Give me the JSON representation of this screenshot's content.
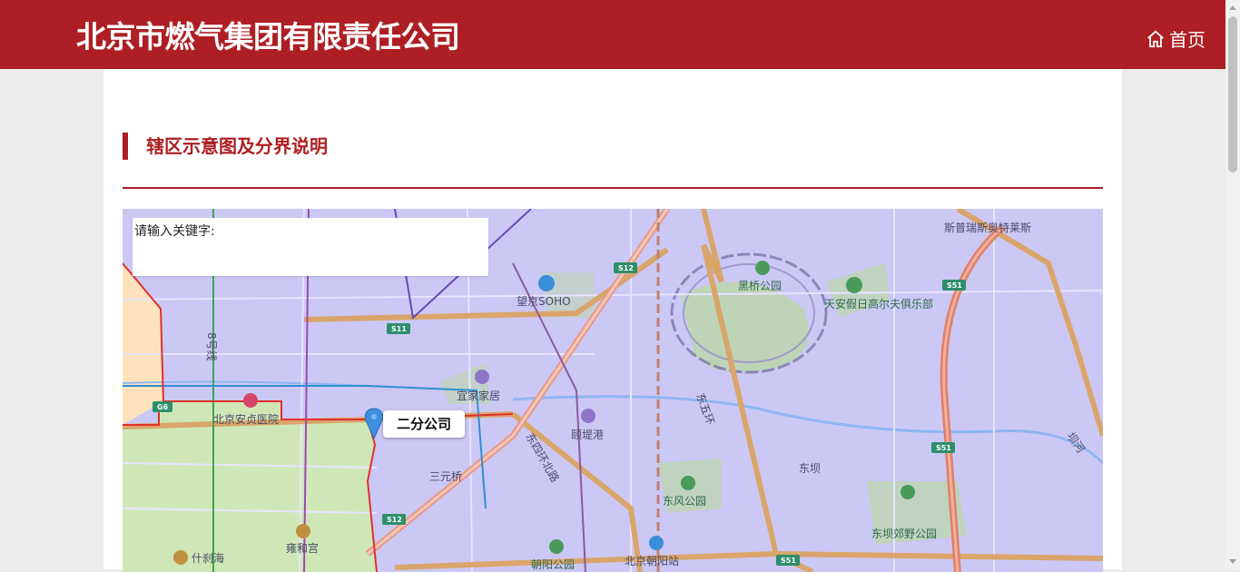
{
  "header": {
    "title": "北京市燃气集团有限责任公司",
    "home_label": "首页",
    "home_icon": "home-icon"
  },
  "section": {
    "title": "辖区示意图及分界说明"
  },
  "map": {
    "search": {
      "label": "请输入关键字:"
    },
    "marker": {
      "label": "二分公司",
      "icon": "map-pin-icon"
    },
    "places": {
      "wangjing_soho": "望京SOHO",
      "heiqiao_park": "黑桥公园",
      "tianan_golf": "天安假日高尔夫俱乐部",
      "swede_outlet": "斯普瑞斯奥特莱斯",
      "ikea": "宜家家居",
      "anzhen_hospital": "北京安贞医院",
      "yidi_port": "颐堤港",
      "dongsi_ring": "东四环北路",
      "dongwu_ring": "东五环",
      "sanyuan_bridge": "三元桥",
      "dongfeng_park": "东风公园",
      "dongba": "东坝",
      "dongba_park": "东坝郊野公园",
      "yonghe_temple": "雍和宫",
      "shichahai": "什刹海",
      "chaoyang_park": "朝阳公园",
      "chaoyang_station": "北京朝阳站",
      "ba_river": "坝河",
      "line8": "8号线"
    },
    "badges": {
      "s12_top": "S12",
      "s11": "S11",
      "s51_right": "S51",
      "s51_mid": "S51",
      "s12_bottom": "S12",
      "s51_bottom": "S51",
      "g6": "G6"
    },
    "colors": {
      "district_fill": "#ccc8f5",
      "other_district": "#cfe7b6",
      "boundary": "#e0312b",
      "ring_road": "#d9a56a"
    }
  },
  "colors": {
    "brand": "#ad1f24"
  }
}
